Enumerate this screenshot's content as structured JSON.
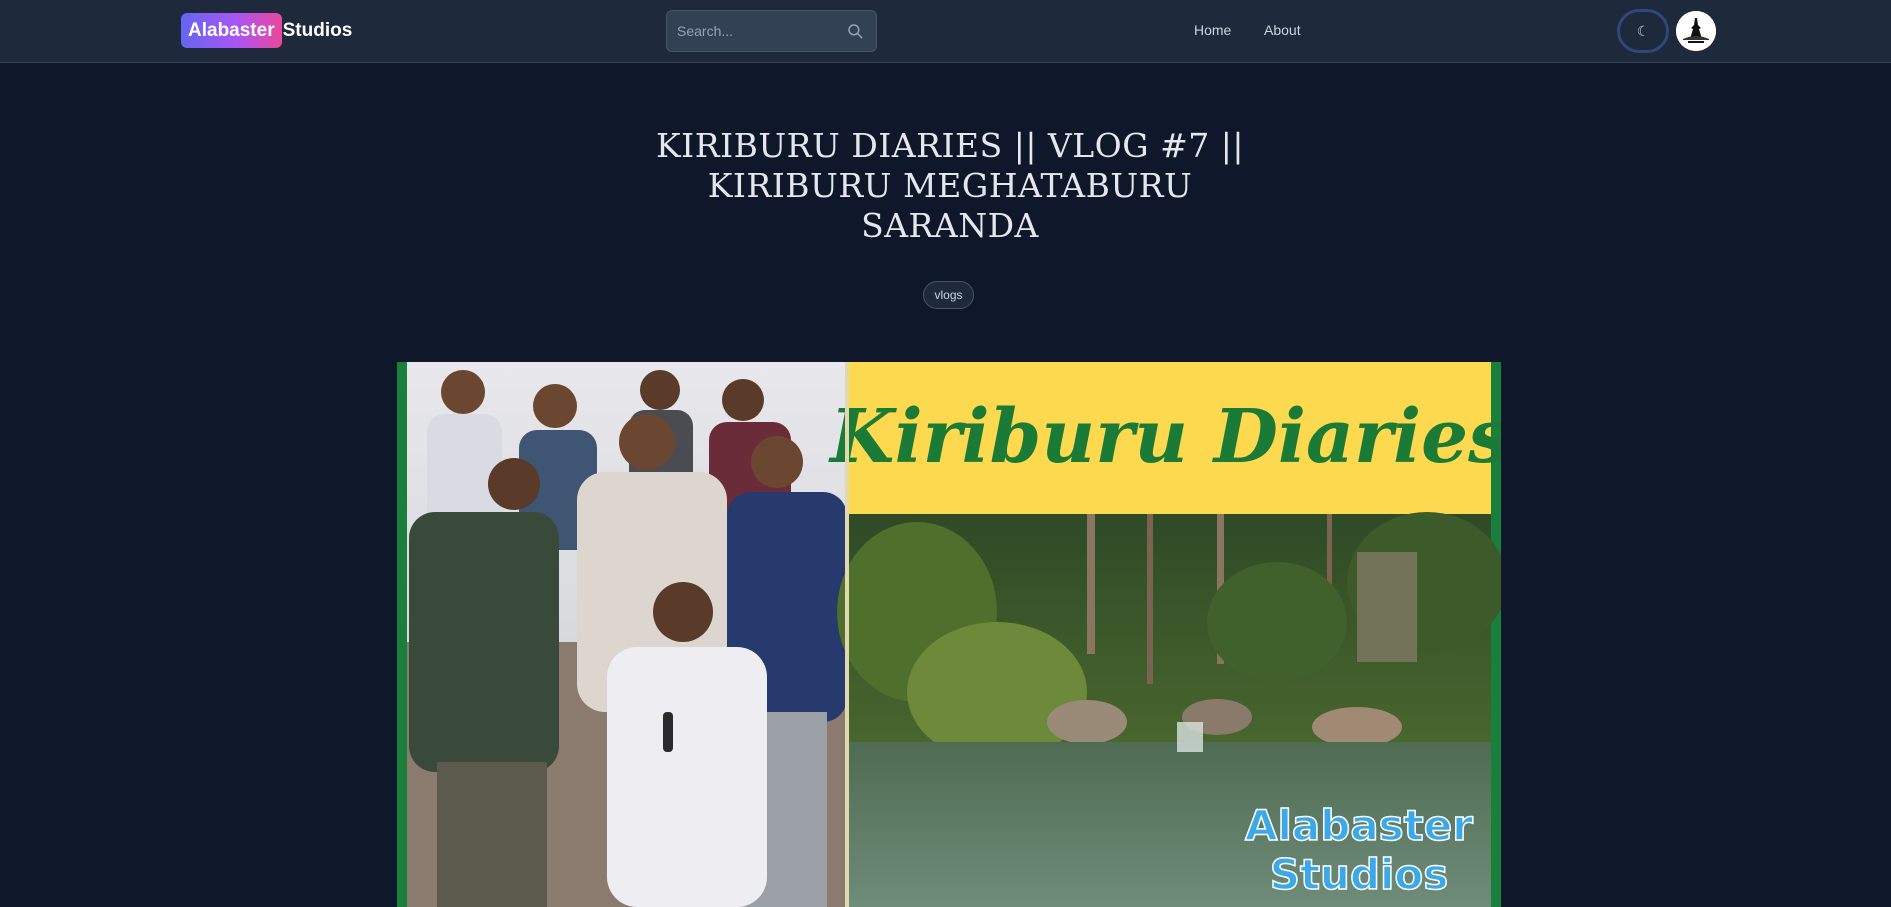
{
  "header": {
    "brand": {
      "highlight": "Alabaster",
      "rest": "Studios"
    },
    "search": {
      "placeholder": "Search...",
      "value": ""
    },
    "nav": [
      {
        "label": "Home"
      },
      {
        "label": "About"
      }
    ],
    "theme_toggle": {
      "icon": "moon-icon",
      "glyph": "☾"
    },
    "avatar": {
      "icon": "logo-avatar"
    }
  },
  "post": {
    "title": "KIRIBURU DIARIES || VLOG #7 || KIRIBURU MEGHATABURU SARANDA",
    "tags": [
      "vlogs"
    ],
    "thumbnail": {
      "headline": "Kiriburu Diaries",
      "watermark_line1": "Alabaster",
      "watermark_line2": "Studios"
    }
  },
  "colors": {
    "page_bg": "#0f172a",
    "header_bg": "#1e293b",
    "brand_gradient_start": "#6366f1",
    "brand_gradient_end": "#ec4899",
    "thumbnail_banner": "#fcd94f",
    "thumbnail_banner_text": "#1b7a36",
    "thumbnail_frame": "#1a7f3a",
    "thumbnail_watermark": "#3ba8e8"
  }
}
